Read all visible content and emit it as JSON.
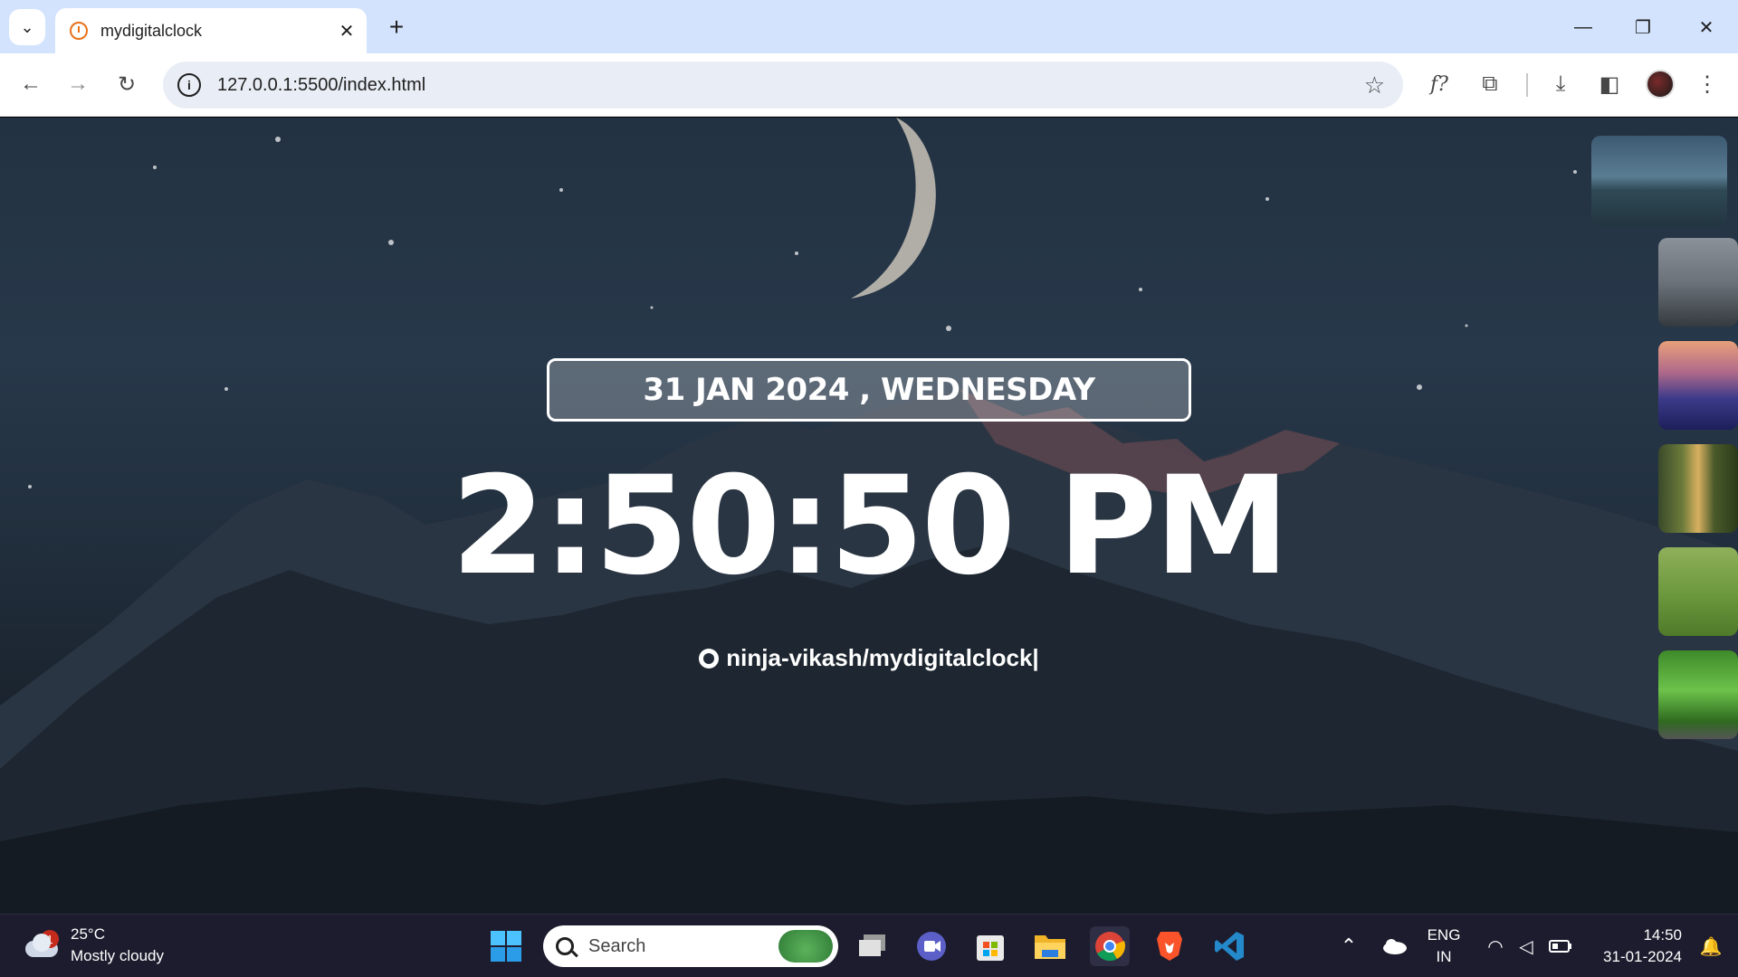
{
  "browser": {
    "tab_title": "mydigitalclock",
    "new_tab_symbol": "+",
    "url": "127.0.0.1:5500/index.html",
    "toolbar_icons": [
      "back-icon",
      "forward-icon",
      "reload-icon",
      "info-icon",
      "star-icon",
      "font-icon",
      "extensions-icon",
      "download-icon",
      "sidepanel-icon",
      "profile-avatar",
      "menu-icon"
    ],
    "font_icon_label": "f?"
  },
  "page": {
    "date": "31 JAN 2024 , WEDNESDAY",
    "time": "2:50:50 PM",
    "github_link": "ninja-vikash/mydigitalclock|",
    "thumbnails": [
      "mountain-moon",
      "misty-forest",
      "sunset-hills",
      "forest-trail",
      "grass-field",
      "green-leaves"
    ]
  },
  "taskbar": {
    "weather_temp": "25°C",
    "weather_desc": "Mostly cloudy",
    "weather_badge": "1",
    "search_placeholder": "Search",
    "language_line1": "ENG",
    "language_line2": "IN",
    "clock_time": "14:50",
    "clock_date": "31-01-2024",
    "apps": [
      "start-icon",
      "task-view-icon",
      "meet-icon",
      "store-icon",
      "file-explorer-icon",
      "chrome-icon",
      "brave-icon",
      "vscode-icon"
    ]
  },
  "colors": {
    "tabbar_bg": "#d3e3fd",
    "omnibox_bg": "#e9eef6",
    "taskbar_bg": "#1c1c2e",
    "sky": "#233242"
  }
}
